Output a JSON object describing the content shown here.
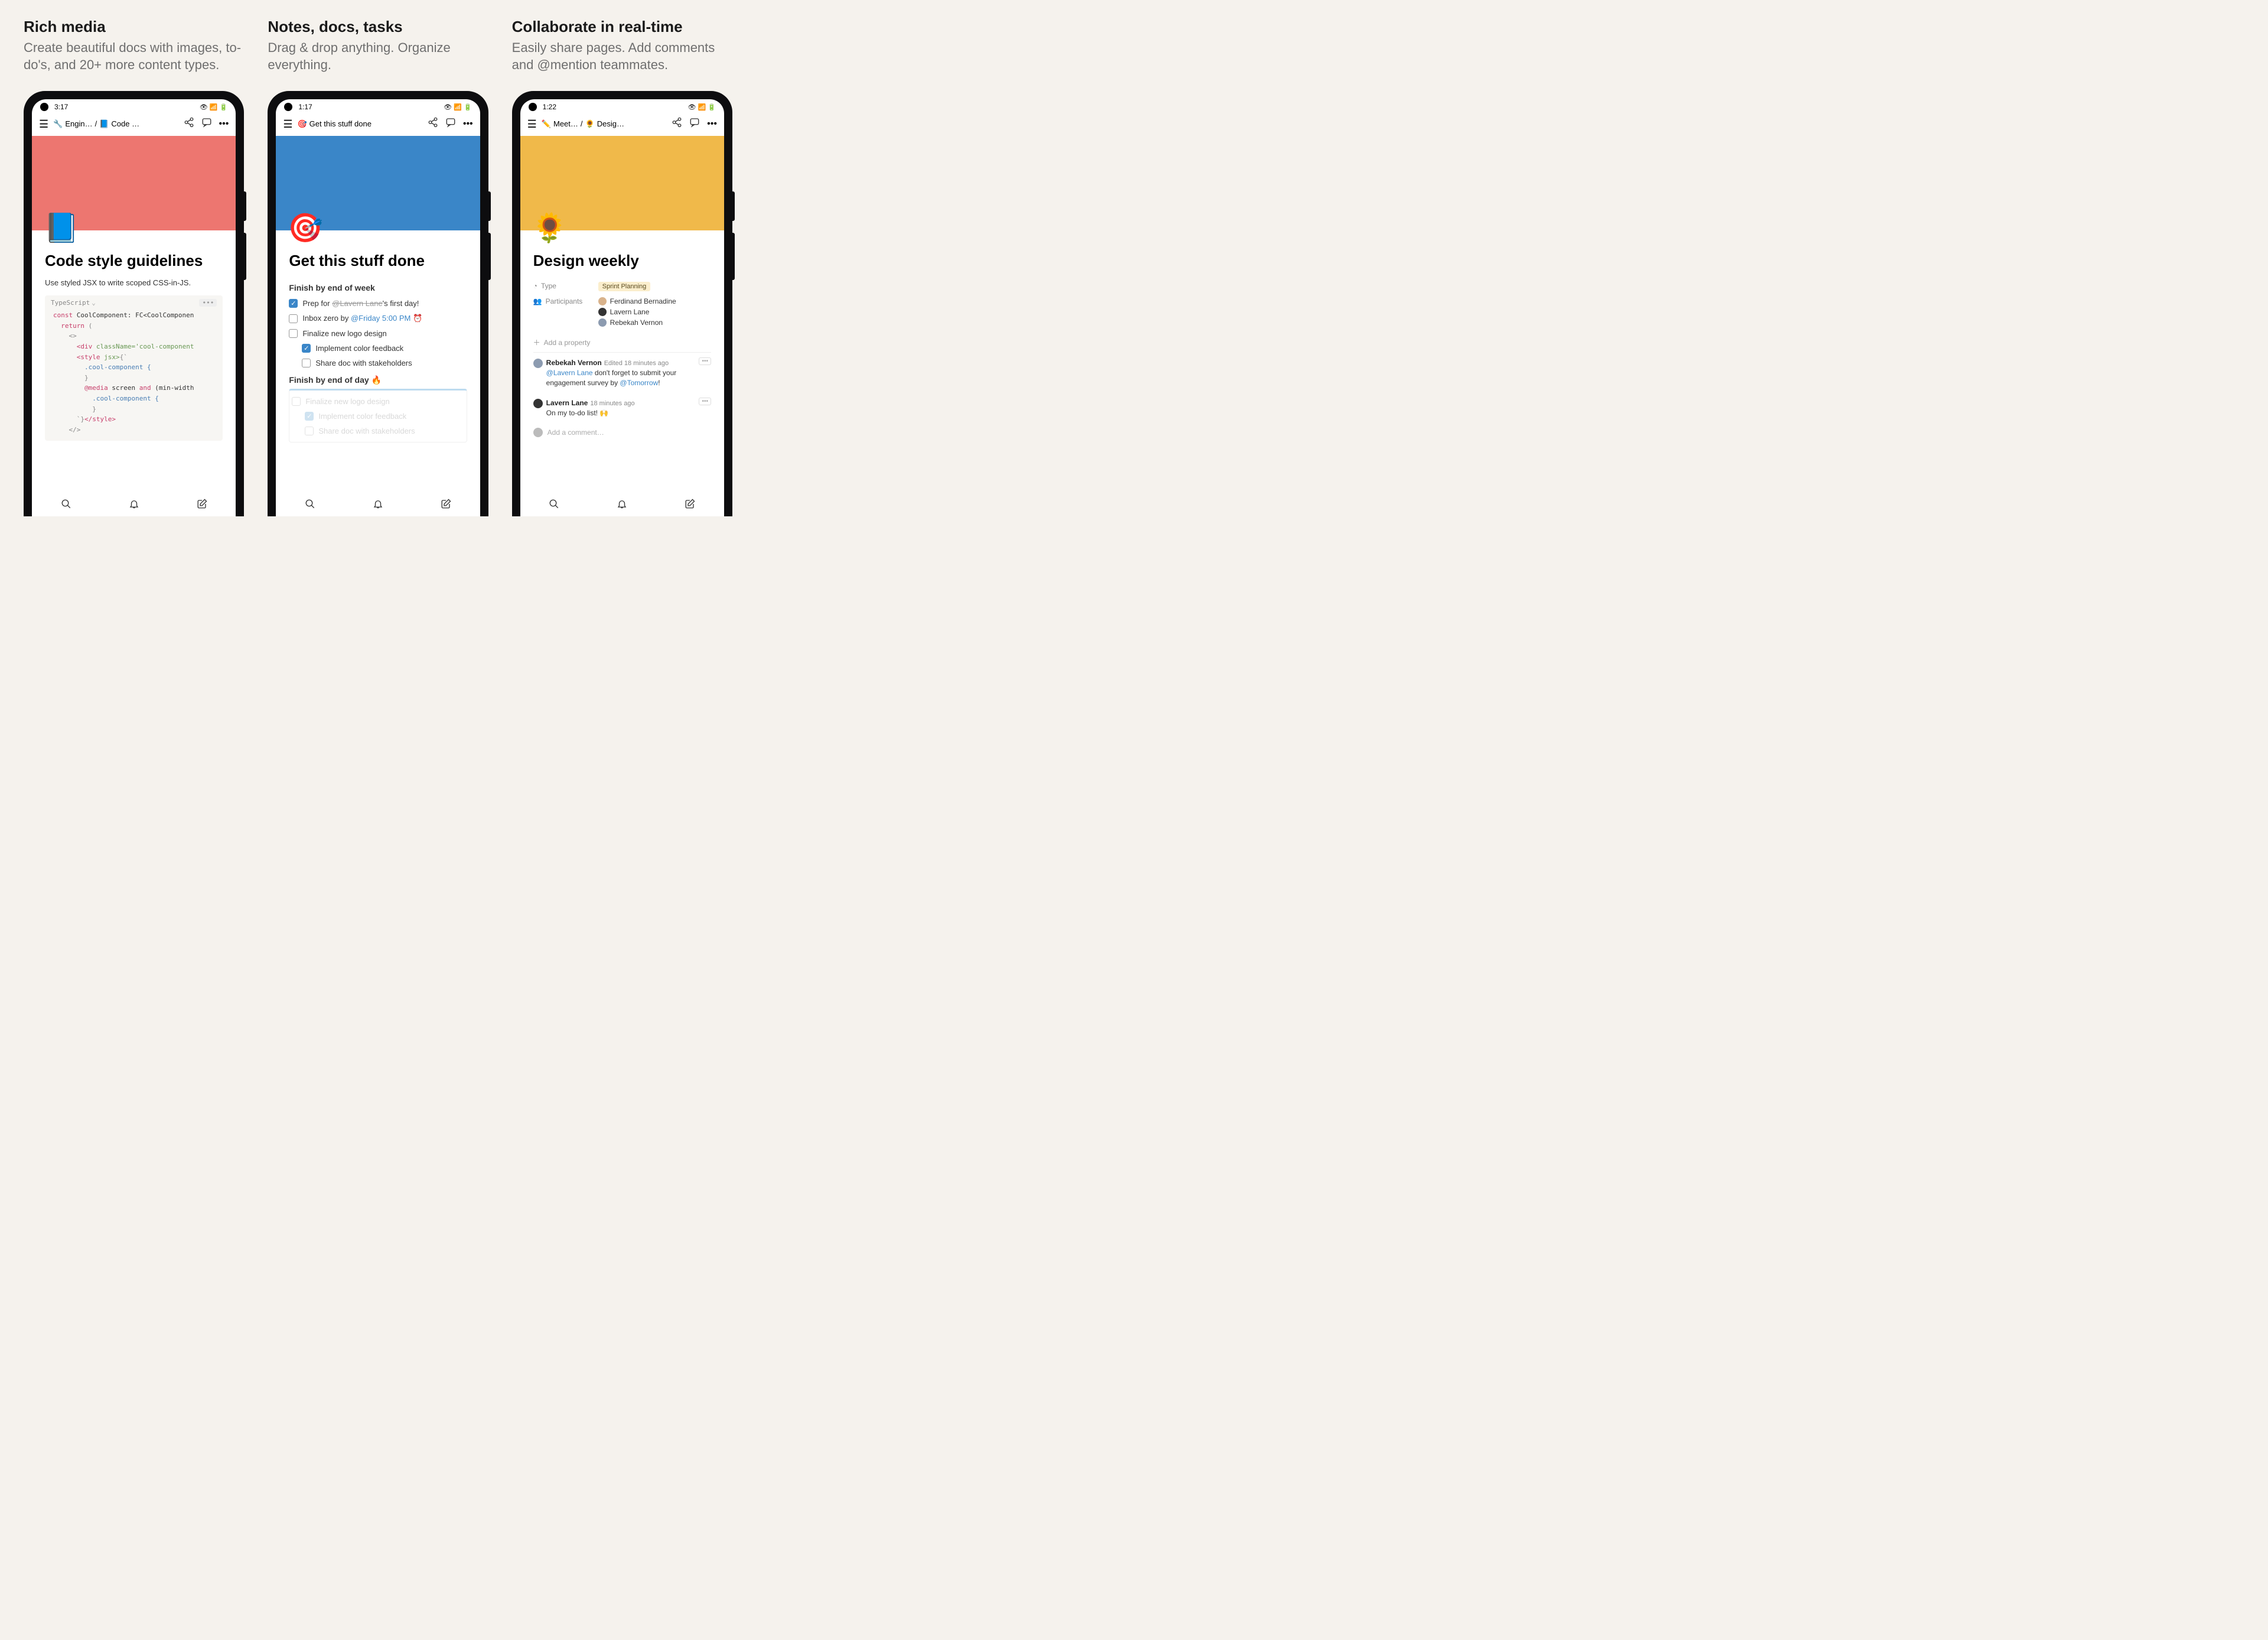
{
  "panels": {
    "p1": {
      "headline": "Rich media",
      "subhead": "Create beautiful docs with images, to-do's, and 20+ more content types."
    },
    "p2": {
      "headline": "Notes, docs, tasks",
      "subhead": "Drag & drop anything. Organize everything."
    },
    "p3": {
      "headline": "Collaborate in real-time",
      "subhead": "Easily share pages. Add comments and @mention teammates."
    }
  },
  "phone1": {
    "time": "3:17",
    "crumb_parent_icon": "🔧",
    "crumb_parent": "Engin…",
    "crumb_sep": "/",
    "crumb_child_icon": "📘",
    "crumb_child": "Code …",
    "hero_icon": "📘",
    "title": "Code style guidelines",
    "para": "Use styled JSX to write scoped CSS-in-JS.",
    "code_lang": "TypeScript",
    "code_line1_a": "const",
    "code_line1_b": " CoolComponent: FC<CoolComponen",
    "code_line2_a": "return",
    "code_line2_b": " (",
    "code_line3": "<>",
    "code_line4_a": "<div",
    "code_line4_b": " className=",
    "code_line4_c": "'cool-component",
    "code_line5_a": "<style",
    "code_line5_b": " jsx>",
    "code_line5_c": "{`",
    "code_line6": ".cool-component {",
    "code_line7": "}",
    "code_line8_a": "@media",
    "code_line8_b": " screen ",
    "code_line8_c": "and",
    "code_line8_d": " (min-width",
    "code_line9": ".cool-component {",
    "code_line10": "}",
    "code_line11_a": "`}",
    "code_line11_b": "</style>",
    "code_line12": "</>"
  },
  "phone2": {
    "time": "1:17",
    "crumb_icon": "🎯",
    "crumb": "Get this stuff done",
    "hero_icon": "🎯",
    "title": "Get this stuff done",
    "sect1": "Finish by end of week",
    "todo1_a": "Prep for ",
    "todo1_mention": "@Lavern Lane",
    "todo1_b": "'s first day!",
    "todo2_a": "Inbox zero by ",
    "todo2_mention": "@Friday 5:00 PM",
    "todo2_alarm": "⏰",
    "todo3": "Finalize new logo design",
    "todo4": "Implement color feedback",
    "todo5": "Share doc with stakeholders",
    "sect2": "Finish by end of day",
    "sect2_fire": "🔥",
    "ghost1": "Finalize new logo design",
    "ghost2": "Implement color feedback",
    "ghost3": "Share doc with stakeholders"
  },
  "phone3": {
    "time": "1:22",
    "crumb_parent_icon": "✏️",
    "crumb_parent": "Meet…",
    "crumb_sep": "/",
    "crumb_child_icon": "🌻",
    "crumb_child": "Desig…",
    "hero_icon": "🌻",
    "title": "Design weekly",
    "prop_type_label": "Type",
    "prop_type_value": "Sprint Planning",
    "prop_part_label": "Participants",
    "participants": {
      "0": "Ferdinand Bernadine",
      "1": "Lavern Lane",
      "2": "Rebekah Vernon"
    },
    "add_prop": "Add a property",
    "c1_name": "Rebekah Vernon",
    "c1_meta": "Edited 18 minutes ago",
    "c1_body_a": "@Lavern Lane",
    "c1_body_b": " don't forget to submit your engagement survey by ",
    "c1_body_c": "@Tomorrow",
    "c1_body_d": "!",
    "c2_name": "Lavern Lane",
    "c2_meta": "18 minutes ago",
    "c2_body": "On my to-do list! 🙌",
    "add_comment": "Add a comment…"
  }
}
